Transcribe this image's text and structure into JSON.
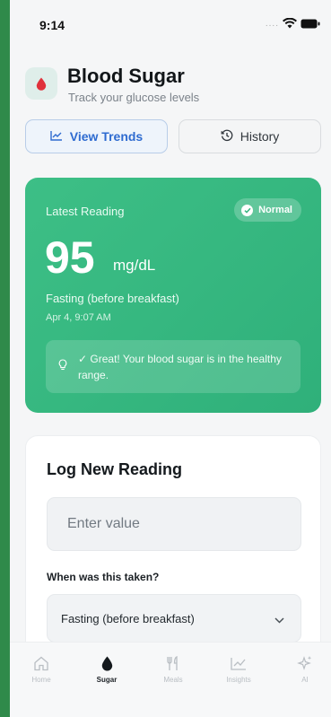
{
  "status_bar": {
    "time": "9:14",
    "signal": "...."
  },
  "header": {
    "title": "Blood Sugar",
    "subtitle": "Track your glucose levels"
  },
  "actions": {
    "trends_label": "View Trends",
    "history_label": "History"
  },
  "latest": {
    "label": "Latest Reading",
    "badge": "Normal",
    "value": "95",
    "unit": "mg/dL",
    "context": "Fasting (before breakfast)",
    "timestamp": "Apr 4, 9:07 AM",
    "tip": "✓ Great! Your blood sugar is in the healthy range."
  },
  "log_form": {
    "title": "Log New Reading",
    "value_placeholder": "Enter value",
    "when_label": "When was this taken?",
    "when_selected": "Fasting (before breakfast)"
  },
  "nav": {
    "items": [
      {
        "label": "Home",
        "icon": "home-icon"
      },
      {
        "label": "Sugar",
        "icon": "drop-icon"
      },
      {
        "label": "Meals",
        "icon": "utensils-icon"
      },
      {
        "label": "Insights",
        "icon": "chart-icon"
      },
      {
        "label": "AI",
        "icon": "sparkle-icon"
      }
    ],
    "active": "Sugar"
  },
  "colors": {
    "accent_green": "#3dbf86",
    "accent_blue": "#2e6bd0",
    "drop_red": "#e0323c"
  }
}
